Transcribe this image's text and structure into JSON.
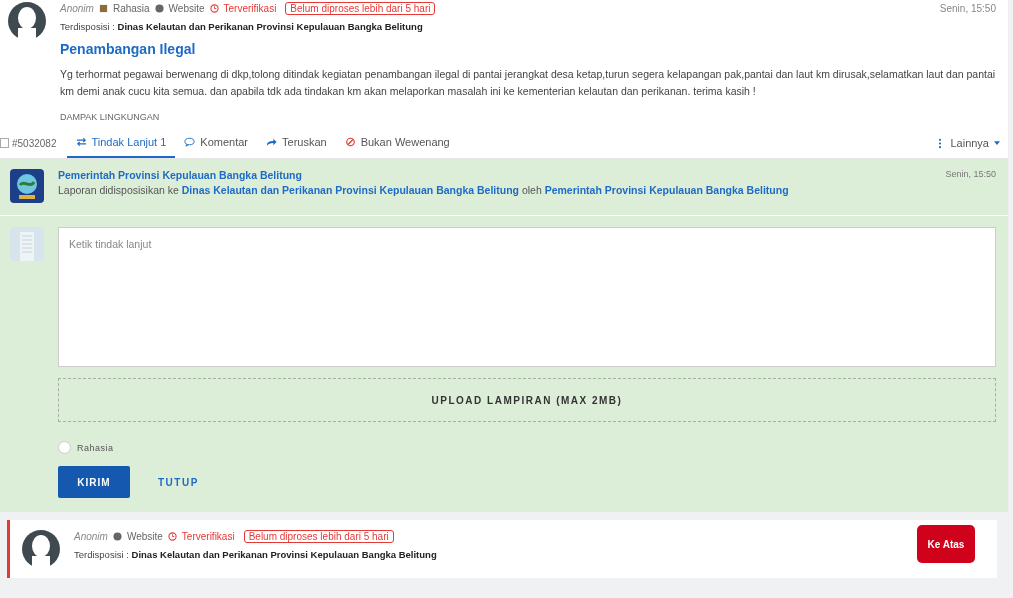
{
  "report": {
    "author": "Anonim",
    "privacy": "Rahasia",
    "source": "Website",
    "verified": "Terverifikasi",
    "overdue_badge": "Belum diproses lebih dari 5 hari",
    "time": "Senin, 15:50",
    "disposition_label": "Terdisposisi :",
    "disposition_target": "Dinas Kelautan dan Perikanan Provinsi Kepulauan Bangka Belitung",
    "title": "Penambangan Ilegal",
    "body": "Yg terhormat pegawai berwenang di dkp,tolong ditindak kegiatan penambangan ilegal di pantai jerangkat desa ketap,turun segera kelapangan pak,pantai dan laut km dirusak,selamatkan laut dan pantai km demi anak cucu kita semua. dan apabila tdk ada tindakan km akan melaporkan masalah ini ke kementerian kelautan dan perikanan. terima kasih !",
    "category": "DAMPAK LINGKUNGAN"
  },
  "report_select": {
    "label": "#5032082",
    "checked": false
  },
  "tabs": [
    {
      "label": "Tindak Lanjut 1",
      "selected": true,
      "kind": "followup"
    },
    {
      "label": "Komentar",
      "selected": false,
      "kind": "comment"
    },
    {
      "label": "Teruskan",
      "selected": false,
      "kind": "forward"
    },
    {
      "label": "Bukan Wewenang",
      "selected": false,
      "kind": "reject"
    }
  ],
  "more_menu": "Lainnya",
  "followups": [
    {
      "agency": "Pemerintah Provinsi Kepulauan Bangka Belitung",
      "message": "Laporan didisposisikan ke",
      "target": "Dinas Kelautan dan Perikanan Provinsi Kepulauan Bangka Belitung",
      "connector": "oleh",
      "source": "Pemerintah Provinsi Kepulauan Bangka Belitung",
      "time": "Senin, 15:50"
    }
  ],
  "reply_form": {
    "placeholder": "Ketik tindak lanjut",
    "upload": "UPLOAD LAMPIRAN (MAX 2MB)",
    "secret": {
      "label": "Rahasia",
      "checked": false
    },
    "submit": "KIRIM",
    "close": "TUTUP"
  },
  "next_report": {
    "author": "Anonim",
    "source": "Website",
    "verified": "Terverifikasi",
    "overdue_badge": "Belum diproses lebih dari 5 hari",
    "disposition_label": "Terdisposisi :",
    "disposition_target": "Dinas Kelautan dan Perikanan Provinsi Kepulauan Bangka Belitung"
  },
  "scroll_top": "Ke Atas"
}
